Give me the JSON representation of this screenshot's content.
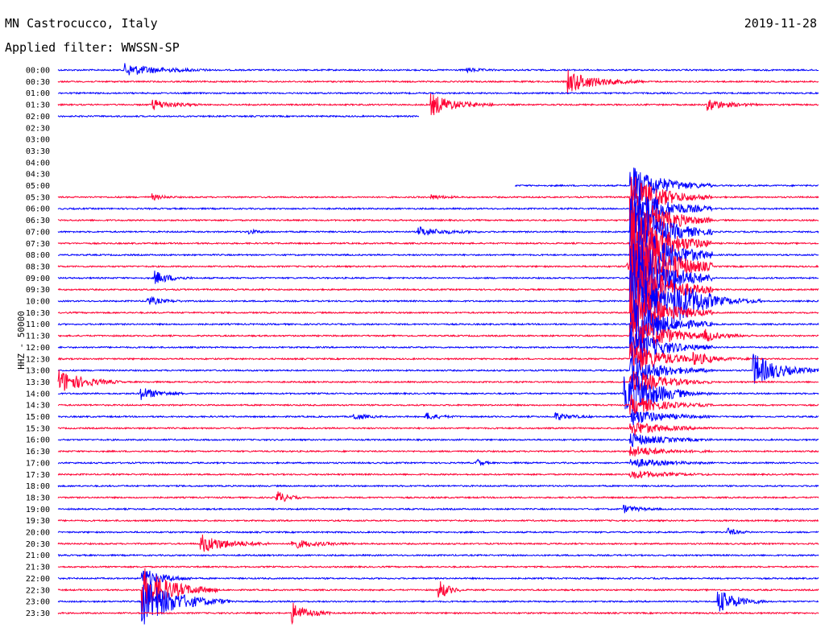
{
  "header": {
    "station": "MN Castrocucco, Italy",
    "date": "2019-11-28",
    "filter": "Applied filter: WWSSN-SP"
  },
  "channel_label": "HHZ - 50000",
  "colors": {
    "blue": "#0000ff",
    "red": "#ff0033"
  },
  "chart_data": {
    "type": "line",
    "title": "MN Castrocucco, Italy",
    "subtitle": "Applied filter: WWSSN-SP",
    "ylabel": "HHZ - 50000",
    "rows": [
      "00:00",
      "00:30",
      "01:00",
      "01:30",
      "02:00",
      "02:30",
      "03:00",
      "03:30",
      "04:00",
      "04:30",
      "05:00",
      "05:30",
      "06:00",
      "06:30",
      "07:00",
      "07:30",
      "08:00",
      "08:30",
      "09:00",
      "09:30",
      "10:00",
      "10:30",
      "11:00",
      "11:30",
      "12:00",
      "12:30",
      "13:00",
      "13:30",
      "14:00",
      "14:30",
      "15:00",
      "15:30",
      "16:00",
      "16:30",
      "17:00",
      "17:30",
      "18:00",
      "18:30",
      "19:00",
      "19:30",
      "20:00",
      "20:30",
      "21:00",
      "21:30",
      "22:00",
      "22:30",
      "23:00",
      "23:30"
    ],
    "tick_labels": [
      "00:00",
      "00:30",
      "01:00",
      "01:30",
      "02:00",
      "02:30",
      "03:00",
      "03:30",
      "04:00",
      "04:30",
      "05:00",
      "05:30",
      "06:00",
      "06:30",
      "07:00",
      "07:30",
      "08:00",
      "08:30",
      "09:00",
      "09:30",
      "10:00",
      "10:30",
      "11:00",
      "11:30",
      "12:00",
      "12:30",
      "13:00",
      "13:30",
      "14:00",
      "14:30",
      "15:00",
      "15:30",
      "16:00",
      "16:30",
      "17:00",
      "17:30",
      "18:00",
      "18:30",
      "19:00",
      "19:30",
      "20:00",
      "20:30",
      "21:00",
      "21:30",
      "22:00",
      "22:30",
      "23:00",
      "23:30"
    ],
    "series_colors": [
      "#0000ff",
      "#ff0033"
    ],
    "x_range": [
      0,
      30
    ],
    "gaps": [
      {
        "row": 4,
        "from": 14.25,
        "to": 30
      },
      {
        "row": 5,
        "from": 0,
        "to": 30
      },
      {
        "row": 6,
        "from": 0,
        "to": 30
      },
      {
        "row": 7,
        "from": 0,
        "to": 30
      },
      {
        "row": 8,
        "from": 0,
        "to": 30
      },
      {
        "row": 9,
        "from": 0,
        "to": 30
      },
      {
        "row": 10,
        "from": 0,
        "to": 18.0
      }
    ],
    "events": [
      {
        "row": 0,
        "t": 2.6,
        "amp": 8,
        "dur": 3.5
      },
      {
        "row": 0,
        "t": 16.1,
        "amp": 3,
        "dur": 1.2
      },
      {
        "row": 1,
        "t": 20.1,
        "amp": 14,
        "dur": 3.0
      },
      {
        "row": 3,
        "t": 3.7,
        "amp": 7,
        "dur": 2.0
      },
      {
        "row": 3,
        "t": 14.7,
        "amp": 14,
        "dur": 2.5
      },
      {
        "row": 3,
        "t": 25.6,
        "amp": 8,
        "dur": 2.0
      },
      {
        "row": 11,
        "t": 3.7,
        "amp": 4,
        "dur": 1.0
      },
      {
        "row": 11,
        "t": 14.7,
        "amp": 3,
        "dur": 1.2
      },
      {
        "row": 14,
        "t": 7.5,
        "amp": 3,
        "dur": 1.0
      },
      {
        "row": 14,
        "t": 14.2,
        "amp": 6,
        "dur": 2.5
      },
      {
        "row": 17,
        "t": 22.4,
        "amp": 5,
        "dur": 1.0
      },
      {
        "row": 18,
        "t": 3.8,
        "amp": 9,
        "dur": 1.5
      },
      {
        "row": 20,
        "t": 3.5,
        "amp": 6,
        "dur": 1.4
      },
      {
        "row": 20,
        "t": 24.3,
        "amp": 20,
        "dur": 3.5
      },
      {
        "row": 23,
        "t": 25.5,
        "amp": 6,
        "dur": 2.0
      },
      {
        "row": 25,
        "t": 25.0,
        "amp": 6,
        "dur": 2.5
      },
      {
        "row": 26,
        "t": 27.4,
        "amp": 22,
        "dur": 2.6
      },
      {
        "row": 27,
        "t": 0.0,
        "amp": 16,
        "dur": 2.5
      },
      {
        "row": 28,
        "t": 3.2,
        "amp": 9,
        "dur": 1.8
      },
      {
        "row": 28,
        "t": 22.3,
        "amp": 22,
        "dur": 2.5
      },
      {
        "row": 30,
        "t": 11.6,
        "amp": 5,
        "dur": 1.2
      },
      {
        "row": 30,
        "t": 14.5,
        "amp": 5,
        "dur": 1.2
      },
      {
        "row": 30,
        "t": 19.6,
        "amp": 5,
        "dur": 1.6
      },
      {
        "row": 34,
        "t": 16.5,
        "amp": 6,
        "dur": 0.6
      },
      {
        "row": 37,
        "t": 8.6,
        "amp": 10,
        "dur": 1.0
      },
      {
        "row": 38,
        "t": 22.3,
        "amp": 5,
        "dur": 1.5
      },
      {
        "row": 40,
        "t": 26.4,
        "amp": 5,
        "dur": 1.0
      },
      {
        "row": 41,
        "t": 5.6,
        "amp": 12,
        "dur": 2.8
      },
      {
        "row": 41,
        "t": 9.2,
        "amp": 6,
        "dur": 2.5
      },
      {
        "row": 44,
        "t": 3.3,
        "amp": 14,
        "dur": 2.0
      },
      {
        "row": 45,
        "t": 3.3,
        "amp": 30,
        "dur": 3.0
      },
      {
        "row": 45,
        "t": 15.0,
        "amp": 14,
        "dur": 1.0
      },
      {
        "row": 46,
        "t": 3.3,
        "amp": 30,
        "dur": 3.5
      },
      {
        "row": 46,
        "t": 26.0,
        "amp": 16,
        "dur": 2.0
      },
      {
        "row": 47,
        "t": 9.2,
        "amp": 14,
        "dur": 1.6
      }
    ],
    "big_quake": {
      "t": 22.6,
      "rows_from": 10,
      "rows_to": 35,
      "peak_row": 17
    }
  }
}
